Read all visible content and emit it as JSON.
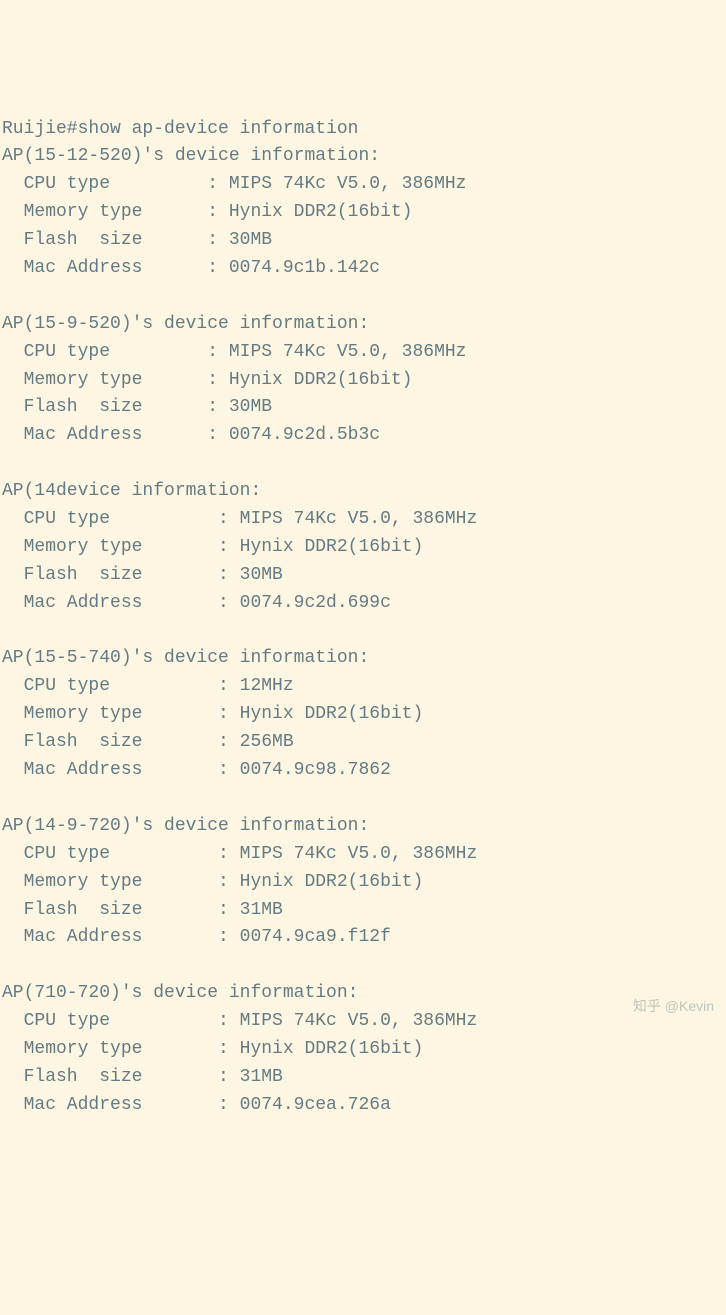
{
  "prompt": "Ruijie#",
  "command": "show ap-device information",
  "devices": [
    {
      "name": "AP(15-12-520)'s device information:",
      "cpu_label": "  CPU type         : ",
      "cpu_value": "MIPS 74Kc V5.0, 386MHz",
      "mem_label": "  Memory type      : ",
      "mem_value": "Hynix DDR2(16bit)",
      "flash_label": "  Flash  size      : ",
      "flash_value": "30MB",
      "mac_label": "  Mac Address      : ",
      "mac_value": "0074.9c1b.142c"
    },
    {
      "name": "AP(15-9-520)'s device information:",
      "cpu_label": "  CPU type         : ",
      "cpu_value": "MIPS 74Kc V5.0, 386MHz",
      "mem_label": "  Memory type      : ",
      "mem_value": "Hynix DDR2(16bit)",
      "flash_label": "  Flash  size      : ",
      "flash_value": "30MB",
      "mac_label": "  Mac Address      : ",
      "mac_value": "0074.9c2d.5b3c"
    },
    {
      "name": "AP(14device information:",
      "cpu_label": "  CPU type          : ",
      "cpu_value": "MIPS 74Kc V5.0, 386MHz",
      "mem_label": "  Memory type       : ",
      "mem_value": "Hynix DDR2(16bit)",
      "flash_label": "  Flash  size       : ",
      "flash_value": "30MB",
      "mac_label": "  Mac Address       : ",
      "mac_value": "0074.9c2d.699c"
    },
    {
      "name": "AP(15-5-740)'s device information:",
      "cpu_label": "  CPU type          : ",
      "cpu_value": "12MHz",
      "mem_label": "  Memory type       : ",
      "mem_value": "Hynix DDR2(16bit)",
      "flash_label": "  Flash  size       : ",
      "flash_value": "256MB",
      "mac_label": "  Mac Address       : ",
      "mac_value": "0074.9c98.7862"
    },
    {
      "name": "AP(14-9-720)'s device information:",
      "cpu_label": "  CPU type          : ",
      "cpu_value": "MIPS 74Kc V5.0, 386MHz",
      "mem_label": "  Memory type       : ",
      "mem_value": "Hynix DDR2(16bit)",
      "flash_label": "  Flash  size       : ",
      "flash_value": "31MB",
      "mac_label": "  Mac Address       : ",
      "mac_value": "0074.9ca9.f12f"
    },
    {
      "name": "AP(710-720)'s device information:",
      "cpu_label": "  CPU type          : ",
      "cpu_value": "MIPS 74Kc V5.0, 386MHz",
      "mem_label": "  Memory type       : ",
      "mem_value": "Hynix DDR2(16bit)",
      "flash_label": "  Flash  size       : ",
      "flash_value": "31MB",
      "mac_label": "  Mac Address       : ",
      "mac_value": "0074.9cea.726a"
    }
  ],
  "watermark": "知乎 @Kevin"
}
